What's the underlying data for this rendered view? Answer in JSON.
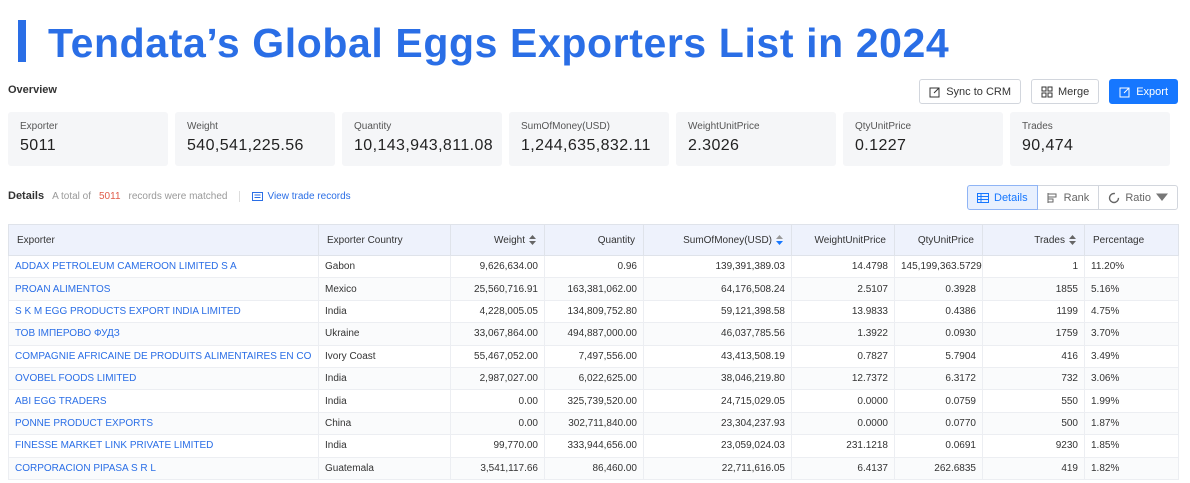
{
  "banner": {
    "title": "Tendata’s Global Eggs Exporters List in 2024"
  },
  "overview": {
    "label": "Overview"
  },
  "actions": {
    "sync_label": "Sync to CRM",
    "merge_label": "Merge",
    "export_label": "Export"
  },
  "stats": [
    {
      "label": "Exporter",
      "value": "5011"
    },
    {
      "label": "Weight",
      "value": "540,541,225.56"
    },
    {
      "label": "Quantity",
      "value": "10,143,943,811.08"
    },
    {
      "label": "SumOfMoney(USD)",
      "value": "1,244,635,832.11"
    },
    {
      "label": "WeightUnitPrice",
      "value": "2.3026"
    },
    {
      "label": "QtyUnitPrice",
      "value": "0.1227"
    },
    {
      "label": "Trades",
      "value": "90,474"
    }
  ],
  "details": {
    "title": "Details",
    "prefix": "A total of",
    "count": "5011",
    "suffix": "records were matched",
    "view_link": "View trade records"
  },
  "view_tabs": {
    "details": "Details",
    "rank": "Rank",
    "ratio": "Ratio"
  },
  "colors": {
    "accent": "#2a6ee6",
    "primary_button": "#1677ff",
    "count": "#e05c4a",
    "header_bg": "#eef2fc"
  },
  "table": {
    "headers": [
      "Exporter",
      "Exporter Country",
      "Weight",
      "Quantity",
      "SumOfMoney(USD)",
      "WeightUnitPrice",
      "QtyUnitPrice",
      "Trades",
      "Percentage"
    ],
    "rows": [
      [
        "ADDAX PETROLEUM CAMEROON LIMITED S A",
        "Gabon",
        "9,626,634.00",
        "0.96",
        "139,391,389.03",
        "14.4798",
        "145,199,363.5729",
        "1",
        "11.20%"
      ],
      [
        "PROAN ALIMENTOS",
        "Mexico",
        "25,560,716.91",
        "163,381,062.00",
        "64,176,508.24",
        "2.5107",
        "0.3928",
        "1855",
        "5.16%"
      ],
      [
        "S K M EGG PRODUCTS EXPORT INDIA LIMITED",
        "India",
        "4,228,005.05",
        "134,809,752.80",
        "59,121,398.58",
        "13.9833",
        "0.4386",
        "1199",
        "4.75%"
      ],
      [
        "ТОВ ІМПЕРОВО ФУДЗ",
        "Ukraine",
        "33,067,864.00",
        "494,887,000.00",
        "46,037,785.56",
        "1.3922",
        "0.0930",
        "1759",
        "3.70%"
      ],
      [
        "COMPAGNIE AFRICAINE DE PRODUITS ALIMENTAIRES EN CO",
        "Ivory Coast",
        "55,467,052.00",
        "7,497,556.00",
        "43,413,508.19",
        "0.7827",
        "5.7904",
        "416",
        "3.49%"
      ],
      [
        "OVOBEL FOODS LIMITED",
        "India",
        "2,987,027.00",
        "6,022,625.00",
        "38,046,219.80",
        "12.7372",
        "6.3172",
        "732",
        "3.06%"
      ],
      [
        "ABI EGG TRADERS",
        "India",
        "0.00",
        "325,739,520.00",
        "24,715,029.05",
        "0.0000",
        "0.0759",
        "550",
        "1.99%"
      ],
      [
        "PONNE PRODUCT EXPORTS",
        "China",
        "0.00",
        "302,711,840.00",
        "23,304,237.93",
        "0.0000",
        "0.0770",
        "500",
        "1.87%"
      ],
      [
        "FINESSE MARKET LINK PRIVATE LIMITED",
        "India",
        "99,770.00",
        "333,944,656.00",
        "23,059,024.03",
        "231.1218",
        "0.0691",
        "9230",
        "1.85%"
      ],
      [
        "CORPORACION PIPASA S R L",
        "Guatemala",
        "3,541,117.66",
        "86,460.00",
        "22,711,616.05",
        "6.4137",
        "262.6835",
        "419",
        "1.82%"
      ]
    ]
  }
}
